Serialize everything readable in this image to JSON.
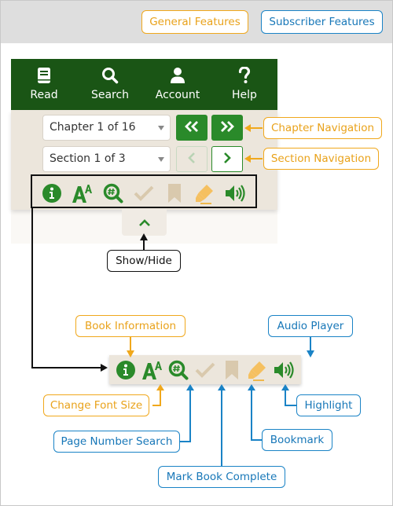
{
  "legend": {
    "general": "General Features",
    "subscriber": "Subscriber Features",
    "colors": {
      "general": "#f0a81c",
      "subscriber": "#1a83c6"
    }
  },
  "navbar": {
    "items": [
      {
        "label": "Read",
        "icon": "book-icon"
      },
      {
        "label": "Search",
        "icon": "search-icon"
      },
      {
        "label": "Account",
        "icon": "user-icon"
      },
      {
        "label": "Help",
        "icon": "question-icon"
      }
    ],
    "color": "#1a5515"
  },
  "chapter_select": {
    "value": "Chapter 1 of 16"
  },
  "section_select": {
    "value": "Section 1 of 3"
  },
  "toolbar_icons": [
    {
      "name": "info-icon",
      "state": "active"
    },
    {
      "name": "font-size-icon",
      "state": "active"
    },
    {
      "name": "page-search-icon",
      "state": "active"
    },
    {
      "name": "checkmark-icon",
      "state": "disabled"
    },
    {
      "name": "bookmark-icon",
      "state": "disabled"
    },
    {
      "name": "highlighter-icon",
      "state": "active"
    },
    {
      "name": "audio-icon",
      "state": "active"
    }
  ],
  "callouts": {
    "chapter_navigation": "Chapter Navigation",
    "section_navigation": "Section Navigation",
    "show_hide": "Show/Hide",
    "book_information": "Book Information",
    "audio_player": "Audio Player",
    "change_font_size": "Change Font Size",
    "highlight": "Highlight",
    "page_number_search": "Page Number Search",
    "bookmark": "Bookmark",
    "mark_book_complete": "Mark Book Complete"
  },
  "colors": {
    "accent_green": "#2a8a2a",
    "panel_beige": "#ece6dc",
    "disabled_tan": "#d9c9ad",
    "highlighter": "#f5c060"
  }
}
